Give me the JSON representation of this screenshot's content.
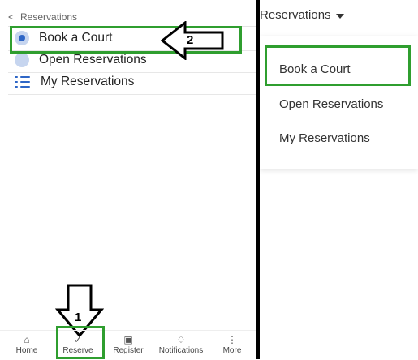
{
  "left_panel": {
    "back_label": "Reservations",
    "items": [
      {
        "label": "Book a Court",
        "icon": "radio-selected-icon"
      },
      {
        "label": "Open Reservations",
        "icon": "radio-icon"
      },
      {
        "label": "My Reservations",
        "icon": "list-icon"
      }
    ],
    "bottom_nav": [
      {
        "label": "Home",
        "icon": "home-icon"
      },
      {
        "label": "Reserve",
        "icon": "check-icon"
      },
      {
        "label": "Register",
        "icon": "calendar-icon"
      },
      {
        "label": "Notifications",
        "icon": "bell-icon"
      },
      {
        "label": "More",
        "icon": "more-icon"
      }
    ]
  },
  "right_panel": {
    "header_label": "Reservations",
    "dropdown_items": [
      "Book a Court",
      "Open Reservations",
      "My Reservations"
    ]
  },
  "annotations": {
    "arrow1_label": "1",
    "arrow2_label": "2",
    "highlight_color": "#2f9e2f"
  },
  "colors": {
    "accent": "#2e66c6",
    "radio_bg": "#c6d5ef",
    "divider": "#000000"
  }
}
